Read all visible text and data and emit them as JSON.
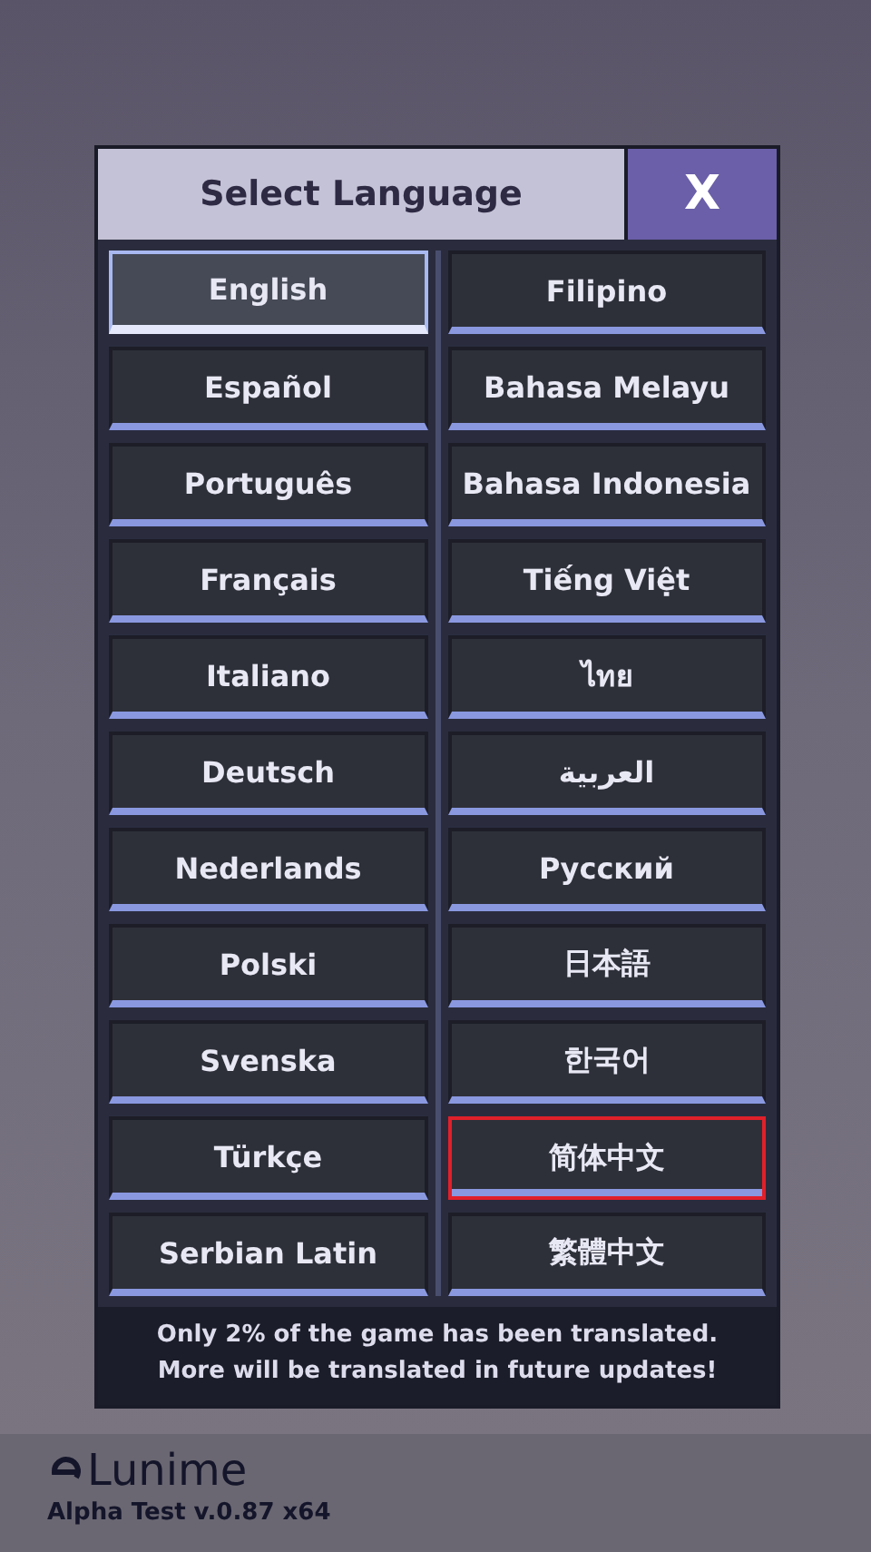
{
  "dialog": {
    "title": "Select Language",
    "close_label": "X"
  },
  "left_column": [
    {
      "label": "English",
      "selected": true,
      "highlighted": false
    },
    {
      "label": "Español",
      "selected": false,
      "highlighted": false
    },
    {
      "label": "Português",
      "selected": false,
      "highlighted": false
    },
    {
      "label": "Français",
      "selected": false,
      "highlighted": false
    },
    {
      "label": "Italiano",
      "selected": false,
      "highlighted": false
    },
    {
      "label": "Deutsch",
      "selected": false,
      "highlighted": false
    },
    {
      "label": "Nederlands",
      "selected": false,
      "highlighted": false
    },
    {
      "label": "Polski",
      "selected": false,
      "highlighted": false
    },
    {
      "label": "Svenska",
      "selected": false,
      "highlighted": false
    },
    {
      "label": "Türkçe",
      "selected": false,
      "highlighted": false
    },
    {
      "label": "Serbian Latin",
      "selected": false,
      "highlighted": false
    }
  ],
  "right_column": [
    {
      "label": "Filipino",
      "selected": false,
      "highlighted": false
    },
    {
      "label": "Bahasa Melayu",
      "selected": false,
      "highlighted": false
    },
    {
      "label": "Bahasa Indonesia",
      "selected": false,
      "highlighted": false
    },
    {
      "label": "Tiếng Việt",
      "selected": false,
      "highlighted": false
    },
    {
      "label": "ไทย",
      "selected": false,
      "highlighted": false
    },
    {
      "label": "العربية",
      "selected": false,
      "highlighted": false
    },
    {
      "label": "Русский",
      "selected": false,
      "highlighted": false
    },
    {
      "label": "日本語",
      "selected": false,
      "highlighted": false
    },
    {
      "label": "한국어",
      "selected": false,
      "highlighted": false
    },
    {
      "label": "简体中文",
      "selected": false,
      "highlighted": true
    },
    {
      "label": "繁體中文",
      "selected": false,
      "highlighted": false
    }
  ],
  "notice": [
    "Only 2% of the game has been translated.",
    "More will be translated in future updates!"
  ],
  "footer": {
    "brand": "Lunime",
    "version": "Alpha Test v.0.87 x64"
  }
}
